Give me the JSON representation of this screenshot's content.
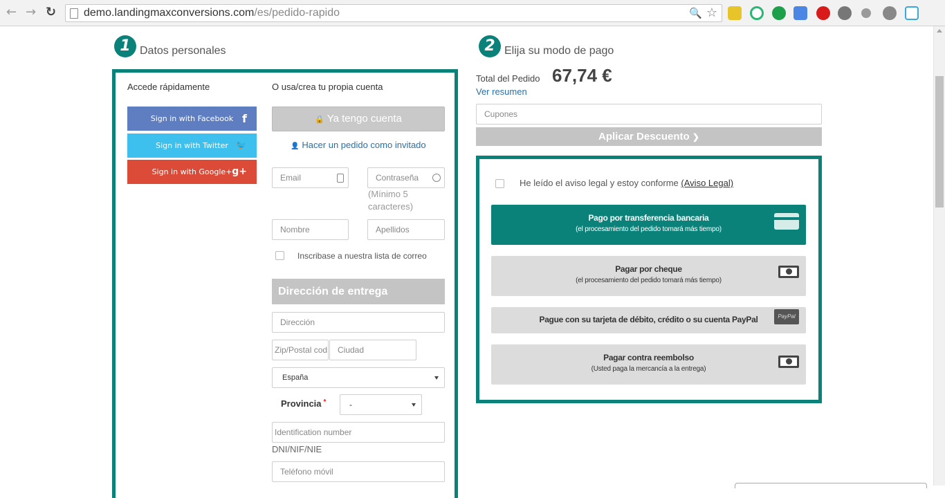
{
  "browser": {
    "url_domain": "demo.landingmaxconversions.com",
    "url_path": "/es/pedido-rapido",
    "back": "←",
    "forward": "→",
    "reload": "↻",
    "zoom_icon": "magnifier-icon",
    "star_icon": "star-icon"
  },
  "section1": {
    "number": "1",
    "title": "Datos personales"
  },
  "section2": {
    "number": "2",
    "title": "Elija su modo de pago"
  },
  "social": {
    "title": "Accede rápidamente",
    "facebook": "Sign in with Facebook",
    "facebook_glyph": "f",
    "twitter": "Sign in with Twitter",
    "twitter_glyph": "🐦",
    "google": "Sign in with Google+",
    "google_glyph": "g+",
    "colors": {
      "facebook": "#5f7ec1",
      "twitter": "#3ec0ef",
      "google": "#dc4a38"
    }
  },
  "account": {
    "title": "O usa/crea tu propia cuenta",
    "ya_tengo": "Ya tengo cuenta",
    "lock_glyph": "🔒",
    "invitado": "Hacer un pedido como invitado",
    "user_glyph": "👤",
    "email_placeholder": "Email",
    "password_placeholder": "Contraseña",
    "password_hint": "(Mínimo 5 caracteres)",
    "nombre_placeholder": "Nombre",
    "apellidos_placeholder": "Apellidos",
    "newsletter": "Inscribase a nuestra lista de correo"
  },
  "delivery": {
    "title": "Dirección de entrega",
    "direccion_placeholder": "Dirección",
    "zip_placeholder": "Zip/Postal cod",
    "ciudad_placeholder": "Ciudad",
    "country": "España",
    "provincia_label": "Provincia",
    "required_mark": "*",
    "provincia_value": "-",
    "id_placeholder": "Identification number",
    "dni_label": "DNI/NIF/NIE",
    "telefono_placeholder": "Teléfono móvil"
  },
  "order": {
    "total_label": "Total del Pedido",
    "total_value": "67,74 €",
    "ver_resumen": "Ver resumen",
    "cupones_placeholder": "Cupones",
    "aplicar": "Aplicar Descuento",
    "aplicar_glyph": "❯"
  },
  "payment": {
    "legal_text": "He leído el aviso legal y estoy conforme",
    "legal_link": "(Aviso Legal)",
    "methods": [
      {
        "main": "Pago por transferencia bancaria",
        "sub": "(el procesamiento del pedido tomará más tiempo)",
        "icon": "credit-card-icon"
      },
      {
        "main": "Pagar por cheque",
        "sub": "(el procesamiento del pedido tomará más tiempo)",
        "icon": "banknote-icon"
      },
      {
        "main": "Pague con su tarjeta de débito, crédito o su cuenta PayPal",
        "sub": "",
        "icon": "paypal-icon",
        "icon_text": "PayPal"
      },
      {
        "main": "Pagar contra reembolso",
        "sub": "(Usted paga la mercancía a la entrega)",
        "icon": "banknote-icon"
      }
    ]
  },
  "colors": {
    "accent": "#0b8279",
    "grey_button": "#c4c4c4",
    "link": "#2a6fa8"
  }
}
